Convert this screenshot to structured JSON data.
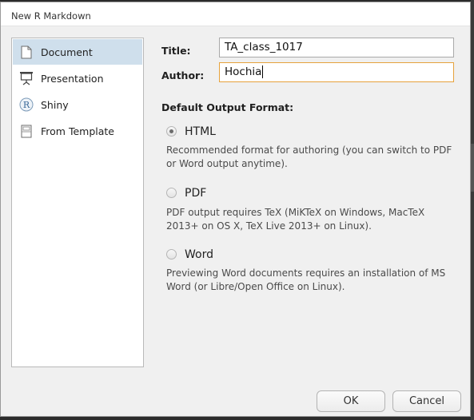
{
  "window": {
    "title": "New R Markdown"
  },
  "sidebar": {
    "items": [
      {
        "label": "Document",
        "icon": "document-icon",
        "selected": true
      },
      {
        "label": "Presentation",
        "icon": "presentation-icon",
        "selected": false
      },
      {
        "label": "Shiny",
        "icon": "shiny-r-icon",
        "selected": false
      },
      {
        "label": "From Template",
        "icon": "template-icon",
        "selected": false
      }
    ]
  },
  "form": {
    "title_label": "Title:",
    "title_value": "TA_class_1017",
    "author_label": "Author:",
    "author_value": "Hochia",
    "author_focus_color": "#e6a23c"
  },
  "output_format": {
    "section_label": "Default Output Format:",
    "selected": "HTML",
    "options": [
      {
        "label": "HTML",
        "description": "Recommended format for authoring (you can switch to PDF or Word output anytime).",
        "checked": true
      },
      {
        "label": "PDF",
        "description": "PDF output requires TeX (MiKTeX on Windows, MacTeX 2013+ on OS X, TeX Live 2013+ on Linux).",
        "checked": false
      },
      {
        "label": "Word",
        "description": "Previewing Word documents requires an installation of MS Word (or Libre/Open Office on Linux).",
        "checked": false
      }
    ]
  },
  "buttons": {
    "ok": "OK",
    "cancel": "Cancel"
  },
  "colors": {
    "selection": "#cfdfec",
    "dialog_bg": "#f0f0f0"
  }
}
